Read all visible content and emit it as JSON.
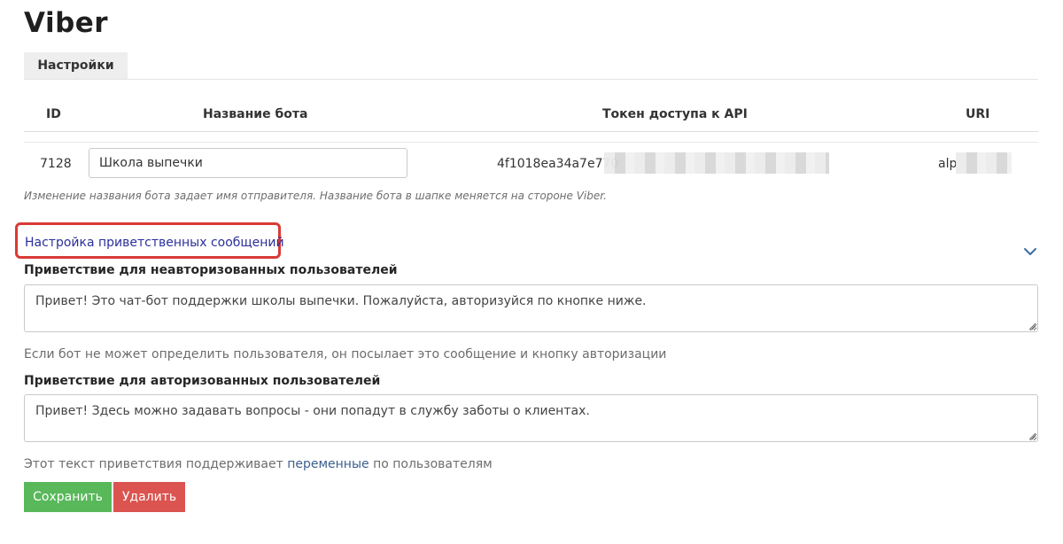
{
  "page": {
    "title": "Viber"
  },
  "tabs": [
    {
      "label": "Настройки"
    }
  ],
  "table": {
    "columns": [
      "ID",
      "Название бота",
      "Токен доступа к API",
      "URI"
    ],
    "row": {
      "id": "7128",
      "bot_name": "Школа выпечки",
      "token_visible": "4f1018ea34a7e770",
      "uri_visible": "alp"
    }
  },
  "bot_name_hint": "Изменение названия бота задает имя отправителя. Название бота в шапке меняется на стороне Viber.",
  "greetings": {
    "section_title": "Настройка приветственных сообщений",
    "unauthorized": {
      "label": "Приветствие для неавторизованных пользователей",
      "value": "Привет! Это чат-бот поддержки школы выпечки. Пожалуйста, авторизуйся по кнопке ниже.",
      "help": "Если бот не может определить пользователя, он посылает это сообщение и кнопку авторизации"
    },
    "authorized": {
      "label": "Приветствие для авторизованных пользователей",
      "value": "Привет! Здесь можно задавать вопросы - они попадут в службу заботы о клиентах.",
      "help_prefix": "Этот текст приветствия поддерживает ",
      "help_link": "переменные",
      "help_suffix": " по пользователям"
    }
  },
  "actions": {
    "save_label": "Сохранить",
    "delete_label": "Удалить"
  },
  "colors": {
    "save": "#58b85a",
    "delete": "#db5450",
    "link": "#2b2f9a",
    "highlight": "#d93a35",
    "chevron": "#3a6ea5"
  },
  "icons": {
    "expand": "chevron-down-icon",
    "resize": "resize-grip-icon"
  }
}
